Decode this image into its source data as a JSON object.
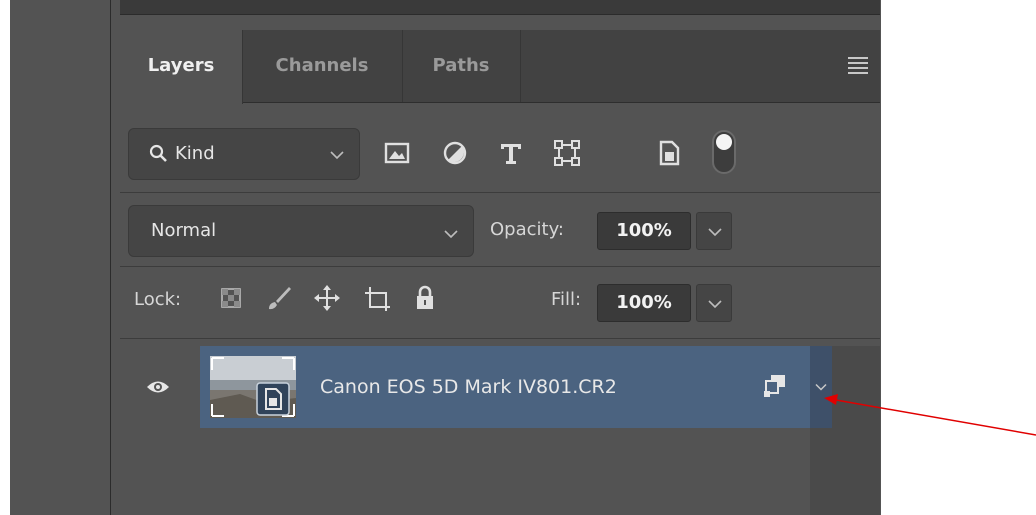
{
  "tabs": [
    {
      "label": "Layers",
      "active": true
    },
    {
      "label": "Channels",
      "active": false
    },
    {
      "label": "Paths",
      "active": false
    }
  ],
  "filter": {
    "kind_label": "Kind",
    "icons": [
      "pixel-layer-filter-icon",
      "adjustment-layer-filter-icon",
      "type-layer-filter-icon",
      "shape-layer-filter-icon",
      "smart-object-filter-icon",
      "filter-toggle-icon"
    ]
  },
  "blend": {
    "mode": "Normal",
    "opacity_label": "Opacity:",
    "opacity_value": "100%"
  },
  "lock": {
    "label": "Lock:",
    "icons": [
      "lock-transparent-pixels-icon",
      "lock-image-pixels-icon",
      "lock-position-icon",
      "lock-artboard-icon",
      "lock-all-icon"
    ],
    "fill_label": "Fill:",
    "fill_value": "100%"
  },
  "layers": [
    {
      "name": "Canon EOS 5D Mark IV801.CR2",
      "visible": true,
      "selected": true,
      "type": "smart-object"
    }
  ],
  "colors": {
    "panel_bg": "#535353",
    "selected_layer": "#4b6380",
    "annotation_arrow": "#e00000"
  }
}
